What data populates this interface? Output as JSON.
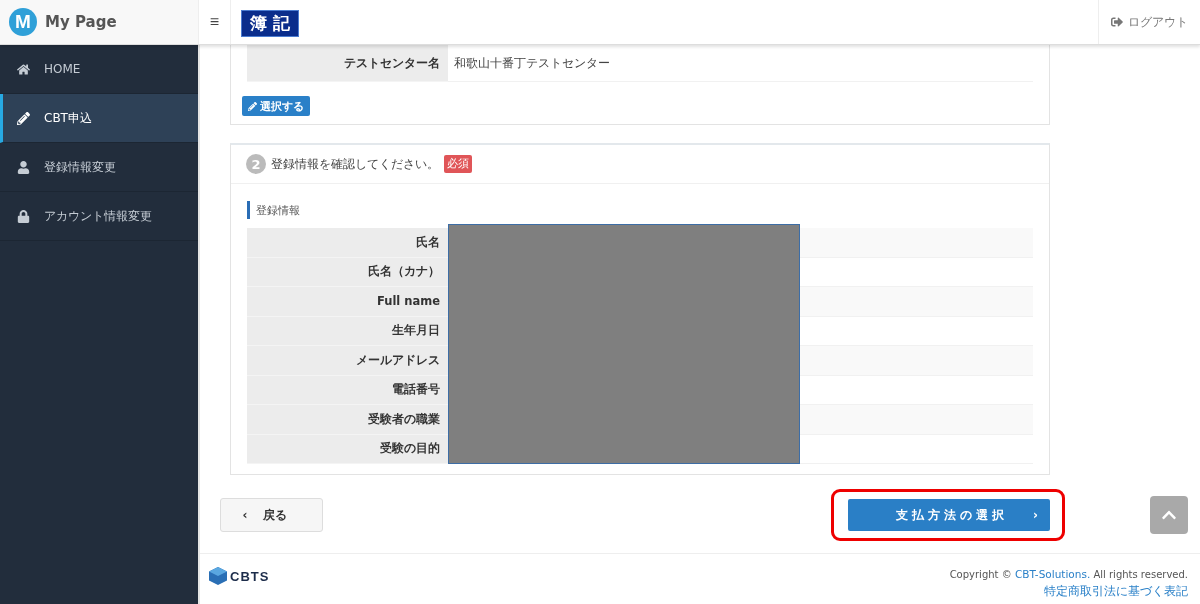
{
  "header": {
    "logo_letter": "M",
    "title": "My Page",
    "menu_glyph": "≡",
    "badge": "簿 記",
    "logout": "ログアウト"
  },
  "sidebar": {
    "items": [
      {
        "label": "HOME",
        "kind": "home",
        "selected": false
      },
      {
        "label": "CBT申込",
        "kind": "pencil",
        "selected": true
      },
      {
        "label": "登録情報変更",
        "kind": "user",
        "selected": false
      },
      {
        "label": "アカウント情報変更",
        "kind": "lock",
        "selected": false
      }
    ]
  },
  "center_section": {
    "rows": [
      {
        "label": "テストセンター名",
        "value": "和歌山十番丁テストセンター"
      }
    ],
    "select_button": "選択する"
  },
  "step": {
    "number": "2",
    "title": "登録情報を確認してください。",
    "required_badge": "必須",
    "subheading": "登録情報",
    "redacted": true,
    "rows": [
      {
        "label": "氏名"
      },
      {
        "label": "氏名（カナ）"
      },
      {
        "label": "Full name"
      },
      {
        "label": "生年月日"
      },
      {
        "label": "メールアドレス"
      },
      {
        "label": "電話番号"
      },
      {
        "label": "受験者の職業"
      },
      {
        "label": "受験の目的"
      }
    ]
  },
  "actions": {
    "back": {
      "glyph": "‹",
      "label": "戻る"
    },
    "next": {
      "label": "支払方法の選択",
      "glyph": "›",
      "highlighted": true
    }
  },
  "footer": {
    "logo_text": "CBTS",
    "copyright_prefix": "Copyright © ",
    "company_link": "CBT-Solutions.",
    "rights": " All rights reserved.",
    "legal_link": "特定商取引法に基づく表記"
  }
}
